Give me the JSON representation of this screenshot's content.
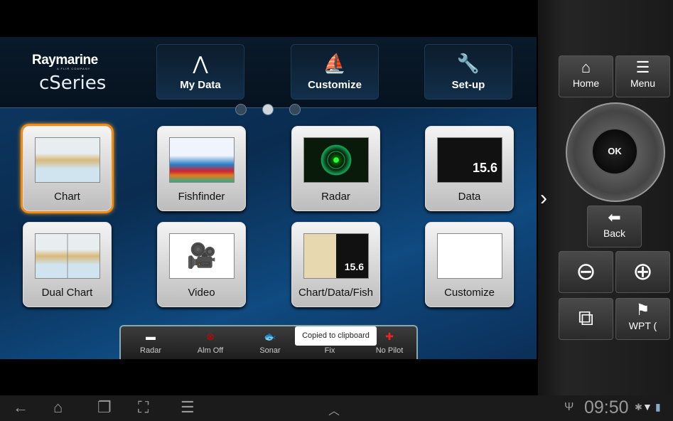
{
  "brand": {
    "name": "Raymarine",
    "tagline": "A FLIR COMPANY",
    "product": "cSeries"
  },
  "header_buttons": [
    {
      "label": "My Data",
      "icon": "network-icon"
    },
    {
      "label": "Customize",
      "icon": "boat-icon"
    },
    {
      "label": "Set-up",
      "icon": "wrench-icon"
    }
  ],
  "page_indicator": {
    "pages": 3,
    "current": 2
  },
  "tiles": [
    {
      "label": "Chart",
      "selected": true
    },
    {
      "label": "Fishfinder"
    },
    {
      "label": "Radar"
    },
    {
      "label": "Data",
      "readout": "15.6"
    },
    {
      "label": "Dual Chart"
    },
    {
      "label": "Video"
    },
    {
      "label": "Chart/Data/Fish",
      "readout": "15.6"
    },
    {
      "label": "Customize"
    }
  ],
  "status_bar": [
    {
      "label": "Radar"
    },
    {
      "label": "Alm Off"
    },
    {
      "label": "Sonar"
    },
    {
      "label": "Fix"
    },
    {
      "label": "No Pilot"
    }
  ],
  "toast": "Copied to clipboard",
  "side": {
    "home": "Home",
    "menu": "Menu",
    "ok": "OK",
    "back": "Back",
    "wpt": "WPT (",
    "expand": "›"
  },
  "android": {
    "time": "09:50"
  },
  "colors": {
    "selection": "#f08a10"
  }
}
